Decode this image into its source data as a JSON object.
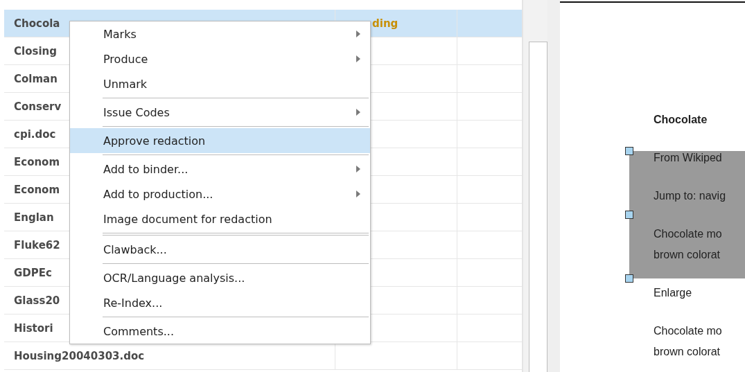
{
  "table": {
    "rows": [
      {
        "name": "Chocola",
        "column_2": "ding",
        "selected": true
      },
      {
        "name": "Closing",
        "selected": false
      },
      {
        "name": "Colman",
        "selected": false
      },
      {
        "name": "Conserv",
        "selected": false
      },
      {
        "name": "cpi.doc",
        "selected": false
      },
      {
        "name": "Econom",
        "selected": false
      },
      {
        "name": "Econom",
        "selected": false
      },
      {
        "name": "Englan",
        "selected": false
      },
      {
        "name": "Fluke62",
        "selected": false
      },
      {
        "name": "GDPEc",
        "selected": false
      },
      {
        "name": "Glass20",
        "selected": false
      },
      {
        "name": "Histori",
        "selected": false
      },
      {
        "name": "Housing20040303.doc",
        "selected": false
      }
    ]
  },
  "context_menu": {
    "items": [
      {
        "kind": "item",
        "label": "Marks",
        "submenu": true,
        "selected": false
      },
      {
        "kind": "item",
        "label": "Produce",
        "submenu": true,
        "selected": false
      },
      {
        "kind": "item",
        "label": "Unmark",
        "submenu": false,
        "selected": false
      },
      {
        "kind": "separator"
      },
      {
        "kind": "item",
        "label": "Issue Codes",
        "submenu": true,
        "selected": false
      },
      {
        "kind": "separator"
      },
      {
        "kind": "item",
        "label": "Approve redaction",
        "submenu": false,
        "selected": true
      },
      {
        "kind": "separator"
      },
      {
        "kind": "item",
        "label": "Add to binder...",
        "submenu": true,
        "selected": false
      },
      {
        "kind": "item",
        "label": "Add to production...",
        "submenu": true,
        "selected": false
      },
      {
        "kind": "item",
        "label": "Image document for redaction",
        "submenu": false,
        "selected": false
      },
      {
        "kind": "separator"
      },
      {
        "kind": "separator"
      },
      {
        "kind": "item",
        "label": "Clawback...",
        "submenu": false,
        "selected": false
      },
      {
        "kind": "separator"
      },
      {
        "kind": "item",
        "label": "OCR/Language analysis...",
        "submenu": false,
        "selected": false
      },
      {
        "kind": "item",
        "label": "Re-Index...",
        "submenu": false,
        "selected": false
      },
      {
        "kind": "separator"
      },
      {
        "kind": "item",
        "label": "Comments...",
        "submenu": false,
        "selected": false
      }
    ]
  },
  "preview": {
    "heading": "Chocolate",
    "redaction": {
      "selected": true,
      "lines": [
        "From Wikiped",
        "Jump to: navig",
        "Chocolate mo",
        "brown colorat"
      ]
    },
    "lines": [
      "Enlarge",
      "Chocolate mo",
      "brown colorat"
    ]
  }
}
